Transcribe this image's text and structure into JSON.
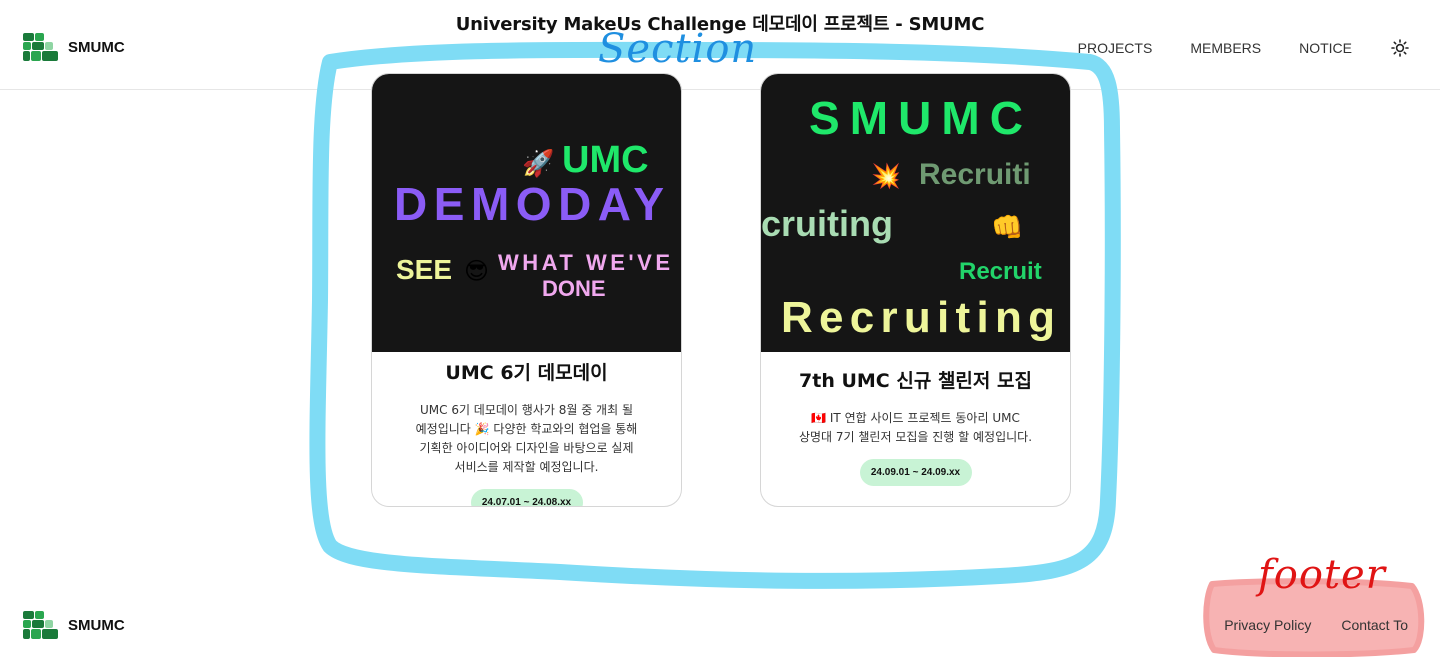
{
  "page": {
    "title": "University MakeUs Challenge 데모데이 프로젝트 - SMUMC"
  },
  "header": {
    "brand": "SMUMC",
    "nav": [
      "PROJECTS",
      "MEMBERS",
      "NOTICE"
    ],
    "theme_icon": "sun-icon"
  },
  "annotations": {
    "section_label": "Section",
    "footer_label": "footer",
    "section_color": "#1f8fe0",
    "footer_color": "#e01414"
  },
  "cards": [
    {
      "title": "UMC 6기 데모데이",
      "description": "UMC 6기 데모데이 행사가 8월 중 개최 될 예정입니다 🎉 다양한 학교와의 협업을 통해 기획한 아이디어와 디자인을 바탕으로 실제 서비스를 제작할 예정입니다.",
      "date": "24.07.01 ~ 24.08.xx",
      "image_text": {
        "line1": "UMC",
        "line2": "DEMODAY",
        "line3a": "SEE",
        "line3b": "WHAT WE'VE",
        "line4": "DONE"
      }
    },
    {
      "title": "7th UMC 신규 챌린저 모집",
      "description": "🇨🇦 IT 연합 사이드 프로젝트 동아리 UMC 상명대 7기 챌린저 모집을 진행 할 예정입니다.",
      "date": "24.09.01 ~ 24.09.xx",
      "image_text": {
        "line1": "SMUMC",
        "line2": "Recruiti",
        "line3": "cruiting",
        "line4": "Recruit",
        "line5": "Recruiting"
      }
    }
  ],
  "footer": {
    "brand": "SMUMC",
    "links": [
      "Privacy Policy",
      "Contact To"
    ]
  },
  "colors": {
    "accent_green": "#1fe86a",
    "date_badge": "#c8f3d5",
    "card_image_bg": "#151515"
  }
}
